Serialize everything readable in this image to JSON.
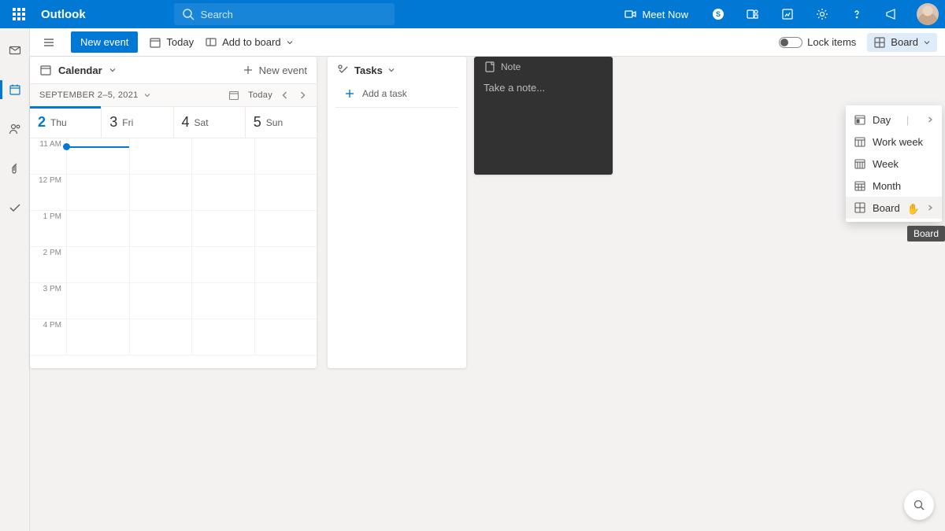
{
  "header": {
    "app_name": "Outlook",
    "search_placeholder": "Search",
    "meet_now": "Meet Now"
  },
  "cmdbar": {
    "new_event": "New event",
    "today": "Today",
    "add_to_board": "Add to board",
    "lock_items": "Lock items",
    "view_label": "Board"
  },
  "view_menu": {
    "items": [
      "Day",
      "Work week",
      "Week",
      "Month",
      "Board"
    ],
    "selected": "Board",
    "tooltip": "Board"
  },
  "calendar_card": {
    "title": "Calendar",
    "new_event": "New event",
    "range_label": "SEPTEMBER 2–5, 2021",
    "today": "Today",
    "days": [
      {
        "num": "2",
        "dow": "Thu",
        "active": true
      },
      {
        "num": "3",
        "dow": "Fri",
        "active": false
      },
      {
        "num": "4",
        "dow": "Sat",
        "active": false
      },
      {
        "num": "5",
        "dow": "Sun",
        "active": false
      }
    ],
    "hours": [
      "11 AM",
      "12 PM",
      "1 PM",
      "2 PM",
      "3 PM",
      "4 PM"
    ]
  },
  "tasks_card": {
    "title": "Tasks",
    "add_placeholder": "Add a task"
  },
  "note_card": {
    "title": "Note",
    "placeholder": "Take a note..."
  }
}
